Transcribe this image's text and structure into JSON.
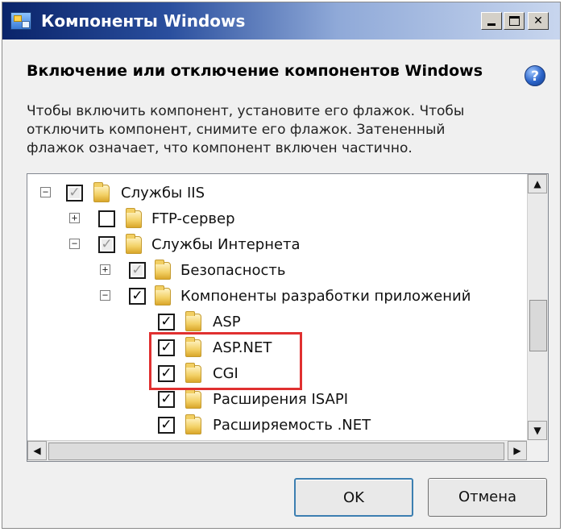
{
  "window": {
    "title": "Компоненты Windows"
  },
  "header": {
    "heading": "Включение или отключение компонентов Windows",
    "help_icon_glyph": "?",
    "description_lines": [
      "Чтобы включить компонент, установите его флажок. Чтобы",
      "отключить компонент, снимите его флажок. Затененный",
      "флажок означает, что компонент включен частично."
    ]
  },
  "tree": {
    "items": [
      {
        "label": "Службы IIS",
        "expander": "−",
        "check": "partial"
      },
      {
        "label": "FTP-сервер",
        "expander": "+",
        "check": "unchecked"
      },
      {
        "label": "Службы Интернета",
        "expander": "−",
        "check": "partial"
      },
      {
        "label": "Безопасность",
        "expander": "+",
        "check": "partial"
      },
      {
        "label": "Компоненты разработки приложений",
        "expander": "−",
        "check": "checked"
      },
      {
        "label": "ASP",
        "expander": "",
        "check": "checked"
      },
      {
        "label": "ASP.NET",
        "expander": "",
        "check": "checked"
      },
      {
        "label": "CGI",
        "expander": "",
        "check": "checked"
      },
      {
        "label": "Расширения ISAPI",
        "expander": "",
        "check": "checked"
      },
      {
        "label": "Расширяемость .NET",
        "expander": "",
        "check": "checked"
      }
    ],
    "scroll_arrows": {
      "up": "▲",
      "down": "▼",
      "left": "◀",
      "right": "▶"
    }
  },
  "buttons": {
    "ok": "OK",
    "cancel": "Отмена"
  },
  "colors": {
    "highlight": "#e03030",
    "titlebar_start": "#0a246a"
  }
}
